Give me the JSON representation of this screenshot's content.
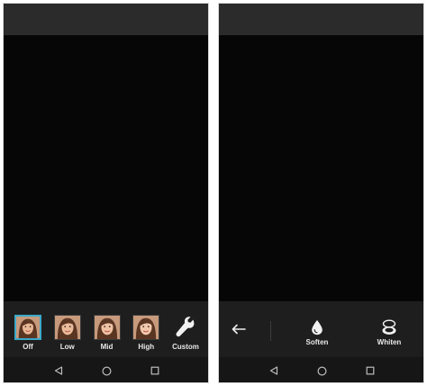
{
  "left_screen": {
    "presets": [
      {
        "label": "Off",
        "selected": true
      },
      {
        "label": "Low",
        "selected": false
      },
      {
        "label": "Mid",
        "selected": false
      },
      {
        "label": "High",
        "selected": false
      }
    ],
    "custom": {
      "label": "Custom",
      "icon": "wrench-icon"
    },
    "nav": {
      "back": "back-triangle-icon",
      "home": "home-circle-icon",
      "recents": "recents-square-icon"
    }
  },
  "right_screen": {
    "back_icon": "arrow-left-icon",
    "tools": [
      {
        "label": "Soften",
        "icon": "droplet-icon"
      },
      {
        "label": "Whiten",
        "icon": "compact-mirror-icon"
      }
    ],
    "nav": {
      "back": "back-triangle-icon",
      "home": "home-circle-icon",
      "recents": "recents-square-icon"
    }
  },
  "colors": {
    "screen_bg": "#161616",
    "viewport_bg": "#060606",
    "status_bar": "#2b2b2b",
    "toolbar": "#1e1e1e",
    "selected_accent": "#3aa9c9",
    "label_text": "#e8e8e8"
  }
}
